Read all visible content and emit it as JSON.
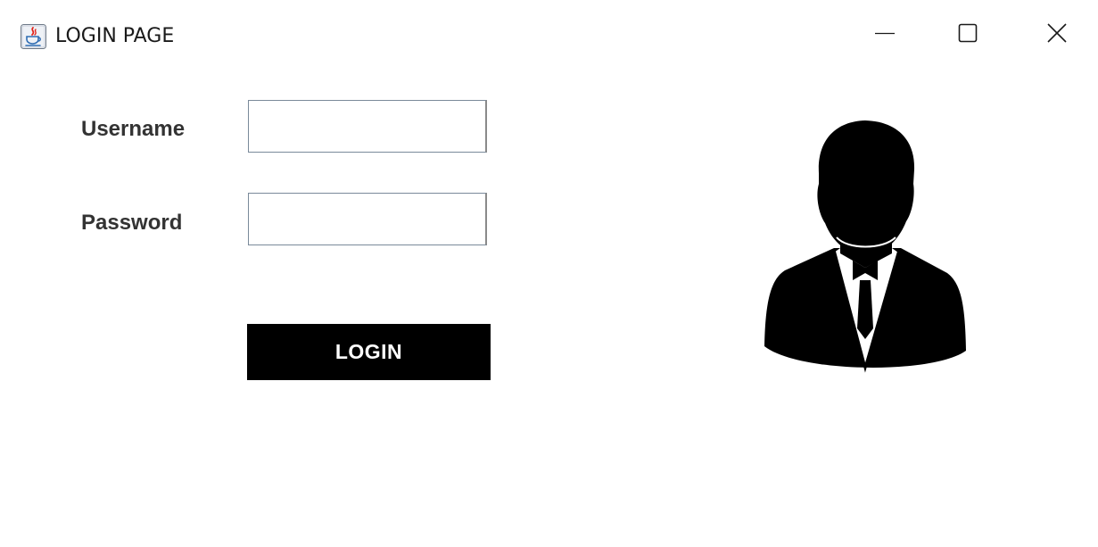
{
  "window": {
    "title": "LOGIN PAGE",
    "app_icon": "java-coffee-cup-icon",
    "controls": {
      "minimize_icon": "minimize-icon",
      "maximize_icon": "maximize-icon",
      "close_icon": "close-icon"
    }
  },
  "form": {
    "username_label": "Username",
    "username_value": "",
    "password_label": "Password",
    "password_value": "",
    "login_label": "LOGIN"
  },
  "illustration": {
    "icon": "businessman-avatar-icon"
  },
  "colors": {
    "button_bg": "#000000",
    "button_text": "#ffffff",
    "label_text": "#333333",
    "field_border": "#7a8a9a"
  }
}
